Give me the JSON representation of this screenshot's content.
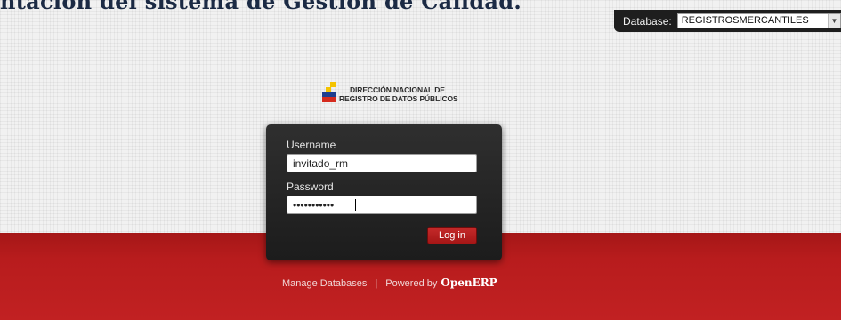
{
  "page": {
    "top_heading": "ntación del sistema de Gestión de Calidad."
  },
  "database": {
    "label": "Database:",
    "selected": "REGISTROSMERCANTILES"
  },
  "logo": {
    "line1": "DIRECCIÓN NACIONAL DE",
    "line2": "REGISTRO DE DATOS PÚBLICOS"
  },
  "login": {
    "username_label": "Username",
    "username_value": "invitado_rm",
    "password_label": "Password",
    "password_value": "•••••••••••",
    "button_label": "Log in"
  },
  "footer": {
    "manage_label": "Manage Databases",
    "separator": "|",
    "powered_label": "Powered by",
    "brand": "OpenERP"
  },
  "colors": {
    "accent_red": "#b81c1d",
    "panel_dark": "#262626",
    "logo_yellow": "#f4c300",
    "logo_blue": "#1f3f8f",
    "logo_red": "#d52b1e"
  }
}
